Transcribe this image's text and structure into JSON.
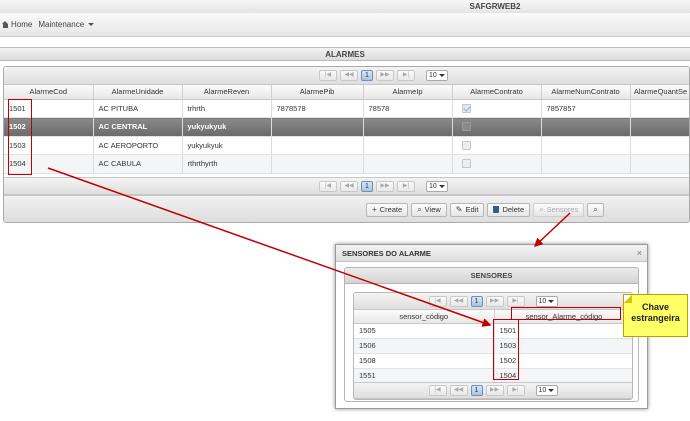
{
  "app": {
    "title": "SAFGRWEB2"
  },
  "nav": {
    "home": "Home",
    "maintenance": "Maintenance"
  },
  "alarmes": {
    "title": "ALARMES",
    "page": "1",
    "rows_per_page": "10",
    "columns": [
      "AlarmeCod",
      "AlarmeUnidade",
      "AlarmeReven",
      "AlarmePib",
      "AlarmeIp",
      "AlarmeContrato",
      "AlarmeNumContrato",
      "AlarmeQuantSe"
    ],
    "rows": [
      {
        "cod": "1501",
        "unidade": "AC PITUBA",
        "reven": "trhrth",
        "pib": "7878578",
        "ip": "78578",
        "contrato": true,
        "num": "7857857",
        "quant": ""
      },
      {
        "cod": "1502",
        "unidade": "AC CENTRAL",
        "reven": "yukyukyuk",
        "pib": "",
        "ip": "",
        "contrato": false,
        "num": "",
        "quant": ""
      },
      {
        "cod": "1503",
        "unidade": "AC AEROPORTO",
        "reven": "yukyukyuk",
        "pib": "",
        "ip": "",
        "contrato": false,
        "num": "",
        "quant": ""
      },
      {
        "cod": "1504",
        "unidade": "AC CABULA",
        "reven": "rthrthyrth",
        "pib": "",
        "ip": "",
        "contrato": false,
        "num": "",
        "quant": ""
      }
    ],
    "toolbar": {
      "create": "Create",
      "view": "View",
      "edit": "Edit",
      "delete": "Delete",
      "sensors": "Sensores"
    }
  },
  "dialog": {
    "title": "SENSORES DO ALARME",
    "close": "×",
    "panel_title": "SENSORES",
    "page": "1",
    "rows_per_page": "10",
    "columns": [
      "sensor_código",
      "sensor_Alarme_código"
    ],
    "rows": [
      {
        "sensor": "1505",
        "alarme": "1501"
      },
      {
        "sensor": "1506",
        "alarme": "1503"
      },
      {
        "sensor": "1508",
        "alarme": "1502"
      },
      {
        "sensor": "1551",
        "alarme": "1504"
      }
    ]
  },
  "annotation": {
    "callout": "Chave estrangeira"
  },
  "colors": {
    "highlight": "#c00000",
    "callout_bg": "#ffff66",
    "selected_row": "#777777",
    "page_active": "#a9c3e2"
  }
}
